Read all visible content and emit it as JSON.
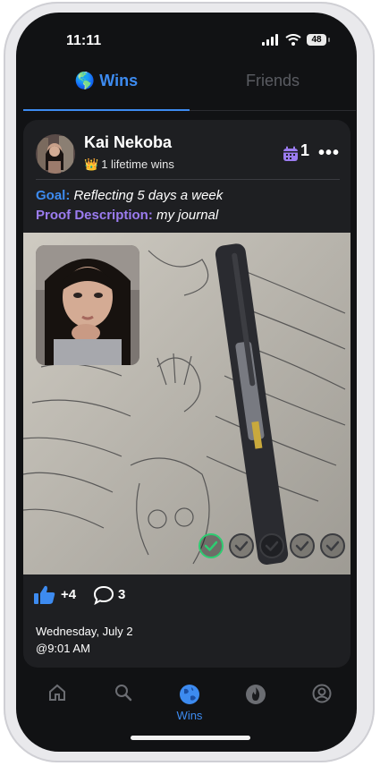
{
  "status_bar": {
    "time": "11:11",
    "battery": "48"
  },
  "tabs": [
    {
      "label": "Wins",
      "active": true
    },
    {
      "label": "Friends",
      "active": false
    }
  ],
  "tabs_wins_emoji": "🌎",
  "post": {
    "username": "Kai Nekoba",
    "lifetime_emoji": "👑",
    "lifetime": "1 lifetime wins",
    "calendar_count": "1",
    "more_label": "•••",
    "goal_label": "Goal:",
    "goal_value": "Reflecting 5 days a week",
    "proof_label": "Proof Description:",
    "proof_value": "my journal",
    "progress": {
      "completed": 1,
      "total": 5
    },
    "likes": "+4",
    "comments": "3",
    "date": "Wednesday, July 2",
    "time": "@9:01 AM"
  },
  "nav": {
    "items": [
      "home-icon",
      "search-icon",
      "globe-icon",
      "fire-icon",
      "profile-icon"
    ],
    "active_label": "Wins"
  },
  "colors": {
    "accent": "#3d8bf0",
    "purple": "#9b7cf0",
    "success": "#2ecc71"
  }
}
